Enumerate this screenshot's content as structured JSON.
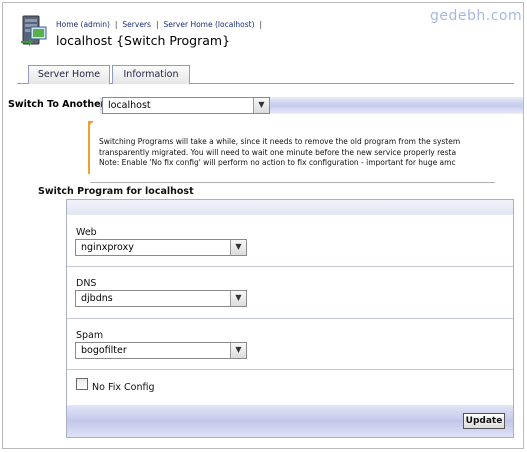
{
  "header": {
    "breadcrumb": [
      "Home (admin)",
      "Servers",
      "Server Home (localhost)"
    ],
    "title": "localhost {Switch Program}",
    "watermark": "gedebh.com"
  },
  "tabs": [
    {
      "label": "Server Home"
    },
    {
      "label": "Information"
    }
  ],
  "switch_to": {
    "label": "Switch To Another",
    "value": "localhost"
  },
  "notice": {
    "lines": [
      "Switching Programs will take a while, since it needs to remove the old program from the system",
      "transparently migrated. You will need to wait one minute before the new service properly resta",
      "Note: Enable 'No fix config' will perform no action to fix configuration - important for huge amc"
    ]
  },
  "section_title": "Switch Program for localhost",
  "fields": [
    {
      "label": "Web",
      "value": "nginxproxy"
    },
    {
      "label": "DNS",
      "value": "djbdns"
    },
    {
      "label": "Spam",
      "value": "bogofilter"
    }
  ],
  "no_fix_config": {
    "label": "No Fix Config",
    "checked": false
  },
  "update_button": "Update",
  "colors": {
    "accent_bar": "#c5cbee",
    "notice_accent": "#f0a030",
    "link": "#1a2c7a",
    "watermark": "#a4b8e6"
  }
}
